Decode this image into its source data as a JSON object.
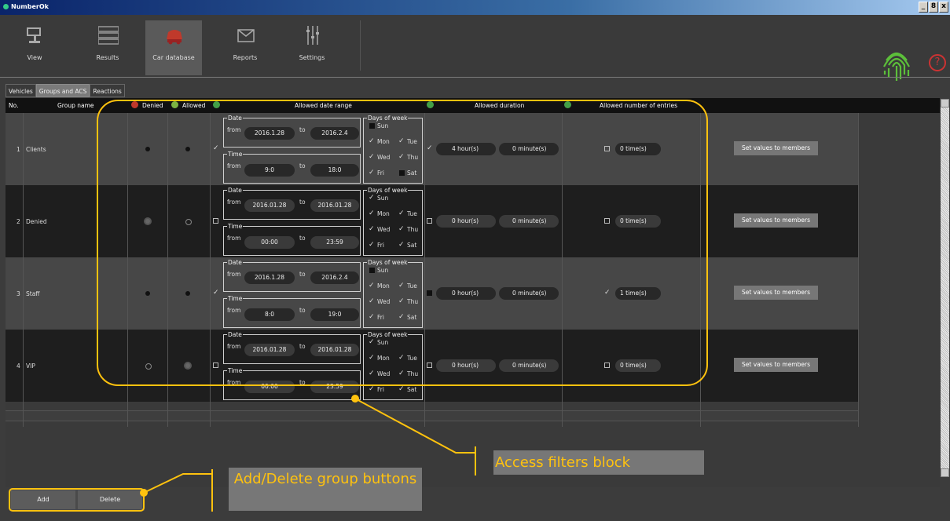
{
  "window": {
    "title": "NumberOk",
    "controls": [
      "_",
      "8",
      "x"
    ]
  },
  "toolbar": {
    "items": [
      {
        "label": "View",
        "icon": "camera-icon"
      },
      {
        "label": "Results",
        "icon": "results-list-icon"
      },
      {
        "label": "Car database",
        "icon": "car-icon",
        "active": true
      },
      {
        "label": "Reports",
        "icon": "envelope-icon"
      },
      {
        "label": "Settings",
        "icon": "sliders-icon"
      }
    ],
    "help": "?"
  },
  "tabs": [
    {
      "label": "Vehicles"
    },
    {
      "label": "Groups and ACS",
      "active": true
    },
    {
      "label": "Reactions"
    }
  ],
  "columns": {
    "no": "No.",
    "group_name": "Group name",
    "denied": "Denied",
    "allowed": "Allowed",
    "date_range": "Allowed date range",
    "duration": "Allowed duration",
    "entries": "Allowed number of entries"
  },
  "labels": {
    "date": "Date",
    "time": "Time",
    "from": "from",
    "to": "to",
    "days": "Days of week",
    "set_values": "Set values to members"
  },
  "rows": [
    {
      "no": "1",
      "name": "Clients",
      "date_from": "2016.1.28",
      "date_to": "2016.2.4",
      "time_from": "9:0",
      "time_to": "18:0",
      "hours": "4 hour(s)",
      "minutes": "0 minute(s)",
      "entries": "0 time(s)"
    },
    {
      "no": "2",
      "name": "Denied",
      "date_from": "2016.01.28",
      "date_to": "2016.01.28",
      "time_from": "00:00",
      "time_to": "23:59",
      "hours": "0 hour(s)",
      "minutes": "0 minute(s)",
      "entries": "0 time(s)"
    },
    {
      "no": "3",
      "name": "Staff",
      "date_from": "2016.1.28",
      "date_to": "2016.2.4",
      "time_from": "8:0",
      "time_to": "19:0",
      "hours": "0 hour(s)",
      "minutes": "0 minute(s)",
      "entries": "1 time(s)"
    },
    {
      "no": "4",
      "name": "VIP",
      "date_from": "2016.01.28",
      "date_to": "2016.01.28",
      "time_from": "00:00",
      "time_to": "23:59",
      "hours": "0 hour(s)",
      "minutes": "0 minute(s)",
      "entries": "0 time(s)"
    }
  ],
  "days": {
    "sun": "Sun",
    "mon": "Mon",
    "tue": "Tue",
    "wed": "Wed",
    "thu": "Thu",
    "fri": "Fri",
    "sat": "Sat"
  },
  "buttons": {
    "add": "Add",
    "delete": "Delete"
  },
  "annotations": {
    "filters": "Access filters block",
    "add_delete": "Add/Delete group buttons",
    "color": "#ffc20e"
  }
}
